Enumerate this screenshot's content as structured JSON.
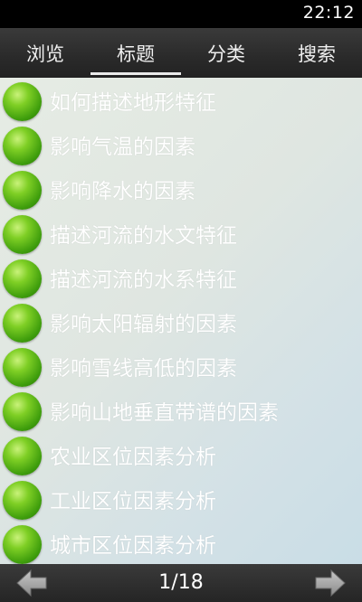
{
  "status_bar": {
    "time": "22:12"
  },
  "tabs": [
    {
      "label": "浏览"
    },
    {
      "label": "标题"
    },
    {
      "label": "分类"
    },
    {
      "label": "搜索"
    }
  ],
  "active_tab": "标题",
  "items": [
    {
      "label": "如何描述地形特征"
    },
    {
      "label": "影响气温的因素"
    },
    {
      "label": "影响降水的因素"
    },
    {
      "label": "描述河流的水文特征"
    },
    {
      "label": "描述河流的水系特征"
    },
    {
      "label": "影响太阳辐射的因素"
    },
    {
      "label": "影响雪线高低的因素"
    },
    {
      "label": "影响山地垂直带谱的因素"
    },
    {
      "label": "农业区位因素分析"
    },
    {
      "label": "工业区位因素分析"
    },
    {
      "label": "城市区位因素分析"
    }
  ],
  "pagination": {
    "indicator": "1/18"
  },
  "icons": {
    "item_bullet": "green-ball-icon",
    "prev": "arrow-left-icon",
    "next": "arrow-right-icon"
  }
}
